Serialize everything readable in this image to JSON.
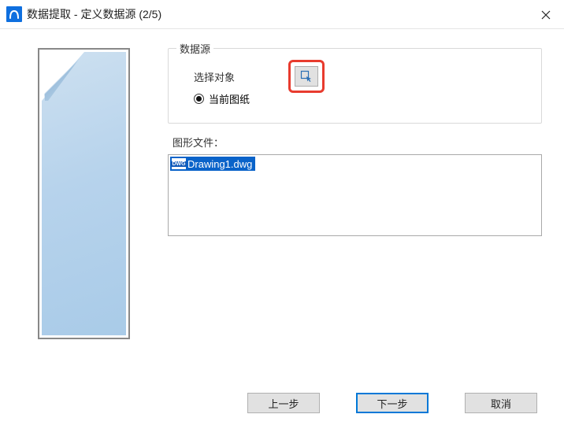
{
  "window": {
    "title": "数据提取 - 定义数据源 (2/5)"
  },
  "dataSource": {
    "legend": "数据源",
    "selectObjectsLabel": "选择对象",
    "currentDrawingLabel": "当前图纸"
  },
  "files": {
    "label": "图形文件：",
    "items": [
      "Drawing1.dwg"
    ]
  },
  "buttons": {
    "back": "上一步",
    "next": "下一步",
    "cancel": "取消"
  }
}
